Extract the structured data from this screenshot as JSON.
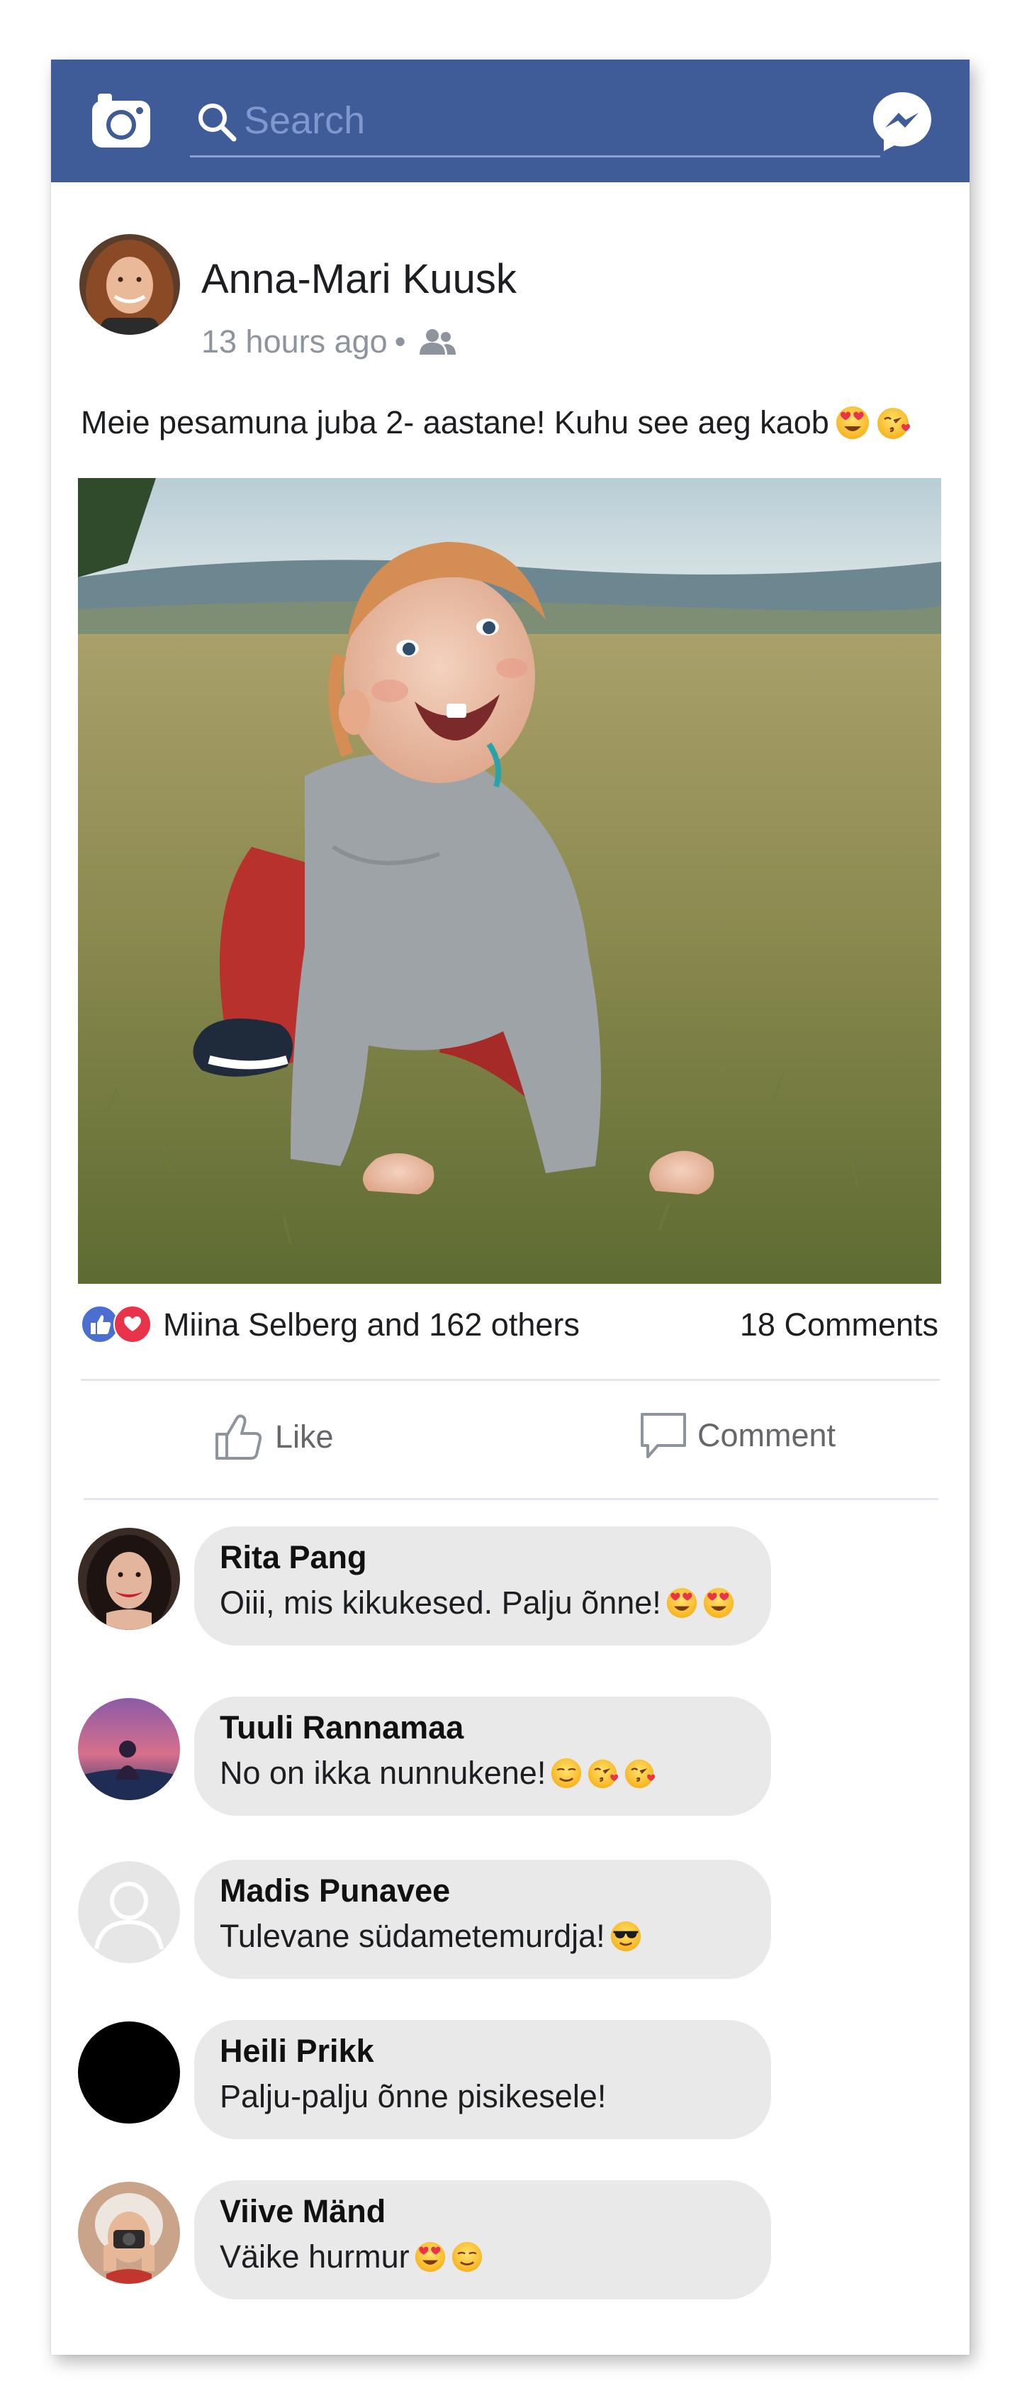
{
  "search": {
    "placeholder": "Search"
  },
  "post": {
    "author": "Anna-Mari Kuusk",
    "time": "13 hours ago",
    "separator": "•",
    "audience_icon": "friends-icon",
    "text": "Meie pesamuna juba 2- aastane! Kuhu see aeg kaob",
    "text_emojis": [
      "heart-eyes-emoji",
      "kissing-heart-emoji"
    ],
    "photo": "baby-crawling-on-grass-photo"
  },
  "reactions": {
    "summary": "Miina Selberg and 162 others",
    "comments_count": "18 Comments",
    "types": [
      "like",
      "love"
    ]
  },
  "actions": {
    "like_label": "Like",
    "comment_label": "Comment"
  },
  "comments": [
    {
      "name": "Rita Pang",
      "text": "Oiii, mis kikukesed. Palju õnne!",
      "emojis": [
        "heart-eyes-emoji",
        "heart-eyes-emoji"
      ]
    },
    {
      "name": "Tuuli Rannamaa",
      "text": "No on ikka nunnukene!",
      "emojis": [
        "smirk-emoji",
        "kissing-heart-emoji",
        "kissing-heart-emoji"
      ]
    },
    {
      "name": "Madis Punavee",
      "text": "Tulevane südametemurdja!",
      "emojis": [
        "sunglasses-emoji"
      ]
    },
    {
      "name": "Heili Prikk",
      "text": "Palju-palju õnne pisikesele!",
      "emojis": []
    },
    {
      "name": "Viive Mänd",
      "text": "Väike hurmur",
      "emojis": [
        "heart-eyes-emoji",
        "smirk-emoji"
      ]
    }
  ],
  "colors": {
    "brand_blue": "#3f5b98",
    "like_blue": "#4a6fd0",
    "love_red": "#e8334a",
    "bubble_gray": "#e9e9e9",
    "muted_text": "#8d949e"
  }
}
